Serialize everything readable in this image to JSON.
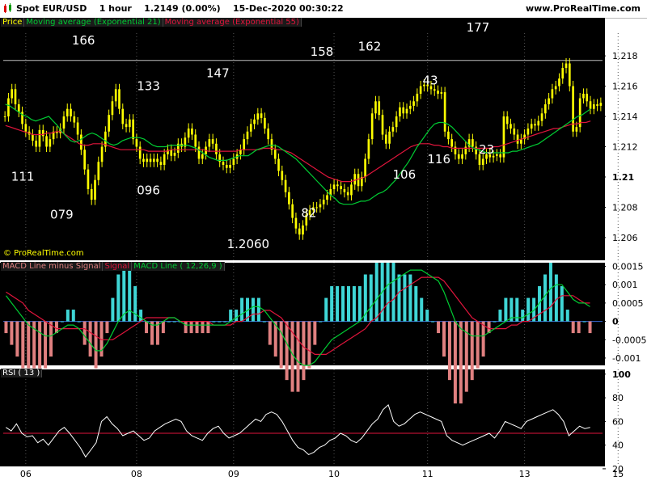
{
  "header": {
    "instrument": "Spot EUR/USD",
    "timeframe": "1 hour",
    "price": "1.2149 (0.00%)",
    "datetime": "15-Dec-2020 00:30:22",
    "site": "www.ProRealTime.com"
  },
  "watermark": "© ProRealTime.com",
  "colors": {
    "background": "#ffffff",
    "panel": "#000000",
    "price": "#ffff00",
    "ema21": "#00cc33",
    "ema55": "#e0153c",
    "macd_hist_pos": "#3fd6d6",
    "macd_hist_neg": "#e08080",
    "signal": "#e0153c",
    "macd_line": "#00cc33",
    "rsi": "#ffffff",
    "rsi_ref": "#e0153c"
  },
  "chart_data": [
    {
      "type": "line",
      "panel": "price",
      "legend": [
        {
          "label": "Price",
          "color": "#ffff00"
        },
        {
          "label": "Moving average (Exponential 21)",
          "color": "#00cc33"
        },
        {
          "label": "Moving average (Exponential 55)",
          "color": "#e0153c"
        }
      ],
      "ylim": [
        1.2045,
        1.2195
      ],
      "y_ticks": [
        "1.206",
        "1.208",
        "1.21",
        "1.212",
        "1.214",
        "1.216",
        "1.218"
      ],
      "y_tick_values": [
        1.206,
        1.208,
        1.21,
        1.212,
        1.214,
        1.216,
        1.218
      ],
      "x_ticks": [
        "06",
        "08",
        "09",
        "10",
        "11",
        "13",
        "15"
      ],
      "x_tick_index": [
        6,
        38,
        66,
        95,
        122,
        150,
        177
      ],
      "reference_line": 1.2177,
      "price": [
        1.214,
        1.2152,
        1.2158,
        1.2148,
        1.2143,
        1.2135,
        1.213,
        1.2128,
        1.2124,
        1.212,
        1.2131,
        1.2127,
        1.212,
        1.2125,
        1.213,
        1.2129,
        1.2132,
        1.214,
        1.2145,
        1.214,
        1.2136,
        1.2128,
        1.2118,
        1.2105,
        1.2092,
        1.2085,
        1.2098,
        1.211,
        1.212,
        1.213,
        1.2141,
        1.215,
        1.2158,
        1.2145,
        1.2135,
        1.2133,
        1.2138,
        1.2125,
        1.212,
        1.2112,
        1.211,
        1.2112,
        1.211,
        1.2112,
        1.211,
        1.2108,
        1.2115,
        1.2118,
        1.2114,
        1.2116,
        1.2122,
        1.212,
        1.2126,
        1.2132,
        1.2128,
        1.212,
        1.2112,
        1.2115,
        1.212,
        1.2125,
        1.2122,
        1.2115,
        1.211,
        1.2108,
        1.2106,
        1.2108,
        1.2112,
        1.2115,
        1.2118,
        1.2125,
        1.213,
        1.2135,
        1.2138,
        1.2142,
        1.2139,
        1.2132,
        1.2125,
        1.2118,
        1.2112,
        1.2104,
        1.2098,
        1.209,
        1.2082,
        1.2073,
        1.2066,
        1.2062,
        1.2068,
        1.2075,
        1.2078,
        1.208,
        1.208,
        1.2082,
        1.2085,
        1.2088,
        1.2092,
        1.2095,
        1.2094,
        1.2092,
        1.209,
        1.2088,
        1.2095,
        1.2102,
        1.2094,
        1.21,
        1.2112,
        1.2125,
        1.2142,
        1.215,
        1.2141,
        1.2128,
        1.2122,
        1.213,
        1.2133,
        1.214,
        1.2146,
        1.2142,
        1.2145,
        1.2147,
        1.215,
        1.2155,
        1.216,
        1.2161,
        1.216,
        1.2158,
        1.2157,
        1.2155,
        1.2156,
        1.213,
        1.2125,
        1.212,
        1.2115,
        1.2112,
        1.2115,
        1.212,
        1.2125,
        1.212,
        1.2115,
        1.2108,
        1.2112,
        1.2115,
        1.2113,
        1.2114,
        1.2115,
        1.2113,
        1.214,
        1.2135,
        1.2132,
        1.2128,
        1.2122,
        1.2125,
        1.2128,
        1.2132,
        1.2135,
        1.2134,
        1.2137,
        1.2142,
        1.2148,
        1.2152,
        1.2158,
        1.216,
        1.2165,
        1.2172,
        1.2175,
        1.216,
        1.213,
        1.2133,
        1.2152,
        1.2155,
        1.215,
        1.2145,
        1.2148,
        1.2147,
        1.2149
      ],
      "ema21": [
        1.2148,
        1.2147,
        1.2145,
        1.2143,
        1.2141,
        1.214,
        1.2138,
        1.2137,
        1.2138,
        1.2139,
        1.214,
        1.2137,
        1.2134,
        1.213,
        1.2127,
        1.2124,
        1.2123,
        1.2124,
        1.2126,
        1.2128,
        1.2129,
        1.2128,
        1.2126,
        1.2124,
        1.2122,
        1.2121,
        1.2122,
        1.2124,
        1.2125,
        1.2126,
        1.2126,
        1.2126,
        1.2125,
        1.2123,
        1.2121,
        1.212,
        1.212,
        1.212,
        1.2121,
        1.2121,
        1.2121,
        1.2121,
        1.2121,
        1.212,
        1.2119,
        1.2117,
        1.2115,
        1.2113,
        1.2112,
        1.2111,
        1.2111,
        1.2111,
        1.2112,
        1.2113,
        1.2114,
        1.2114,
        1.2114,
        1.2116,
        1.2118,
        1.2119,
        1.212,
        1.2121,
        1.2121,
        1.212,
        1.2118,
        1.2116,
        1.2114,
        1.2112,
        1.2109,
        1.2106,
        1.2103,
        1.21,
        1.2097,
        1.2094,
        1.2091,
        1.2088,
        1.2086,
        1.2083,
        1.2082,
        1.2082,
        1.2082,
        1.2083,
        1.2084,
        1.2084,
        1.2085,
        1.2087,
        1.2089,
        1.209,
        1.2092,
        1.2095,
        1.2098,
        1.2102,
        1.2106,
        1.211,
        1.2115,
        1.212,
        1.2124,
        1.2128,
        1.2132,
        1.2135,
        1.2136,
        1.2136,
        1.2135,
        1.2133,
        1.213,
        1.2127,
        1.2124,
        1.2121,
        1.2119,
        1.2118,
        1.2117,
        1.2116,
        1.2116,
        1.2116,
        1.2116,
        1.2116,
        1.2116,
        1.2117,
        1.2117,
        1.2118,
        1.2119,
        1.212,
        1.2121,
        1.2122,
        1.2124,
        1.2126,
        1.2128,
        1.213,
        1.2132,
        1.2134,
        1.2136,
        1.2138,
        1.214,
        1.2141,
        1.2143,
        1.2145
      ],
      "ema55": [
        1.2134,
        1.2133,
        1.2132,
        1.2131,
        1.213,
        1.2129,
        1.2128,
        1.2128,
        1.2128,
        1.2129,
        1.2129,
        1.213,
        1.213,
        1.2128,
        1.2126,
        1.2124,
        1.2122,
        1.2121,
        1.2121,
        1.2122,
        1.2122,
        1.2122,
        1.2121,
        1.212,
        1.2119,
        1.2118,
        1.2118,
        1.2118,
        1.2118,
        1.2118,
        1.2118,
        1.2117,
        1.2117,
        1.2117,
        1.2117,
        1.2117,
        1.2118,
        1.2118,
        1.2118,
        1.2118,
        1.2118,
        1.2118,
        1.2118,
        1.2118,
        1.2117,
        1.2117,
        1.2117,
        1.2117,
        1.2117,
        1.2117,
        1.2117,
        1.2118,
        1.2118,
        1.2118,
        1.2118,
        1.2118,
        1.2119,
        1.2119,
        1.2119,
        1.2118,
        1.2118,
        1.2117,
        1.2116,
        1.2114,
        1.2112,
        1.211,
        1.2108,
        1.2106,
        1.2104,
        1.2102,
        1.21,
        1.2099,
        1.2098,
        1.2097,
        1.2097,
        1.2097,
        1.2098,
        1.2099,
        1.21,
        1.2102,
        1.2104,
        1.2106,
        1.2108,
        1.211,
        1.2112,
        1.2114,
        1.2116,
        1.2118,
        1.212,
        1.2121,
        1.2122,
        1.2122,
        1.2122,
        1.2121,
        1.2121,
        1.212,
        1.212,
        1.2119,
        1.2119,
        1.2119,
        1.2119,
        1.2119,
        1.2119,
        1.2119,
        1.2119,
        1.2119,
        1.212,
        1.212,
        1.2121,
        1.2122,
        1.2123,
        1.2124,
        1.2125,
        1.2126,
        1.2127,
        1.2128,
        1.2129,
        1.213,
        1.2131,
        1.2132,
        1.2132,
        1.2133,
        1.2134,
        1.2135,
        1.2135,
        1.2136,
        1.2136,
        1.2137
      ],
      "annotations": [
        {
          "text": "166",
          "i": 18,
          "y": 1.21875
        },
        {
          "text": "111",
          "i": 4,
          "y": 1.20975
        },
        {
          "text": "079",
          "i": 13,
          "y": 1.20725
        },
        {
          "text": "133",
          "i": 33,
          "y": 1.21575
        },
        {
          "text": "096",
          "i": 33,
          "y": 1.20885
        },
        {
          "text": "147",
          "i": 49,
          "y": 1.2166
        },
        {
          "text": "1.2060",
          "i": 56,
          "y": 1.2053
        },
        {
          "text": "82",
          "i": 70,
          "y": 1.20735
        },
        {
          "text": "158",
          "i": 73,
          "y": 1.218
        },
        {
          "text": "162",
          "i": 84,
          "y": 1.21835
        },
        {
          "text": "106",
          "i": 92,
          "y": 1.2099
        },
        {
          "text": "43",
          "i": 98,
          "y": 1.2161
        },
        {
          "text": "116",
          "i": 100,
          "y": 1.2109
        },
        {
          "text": "177",
          "i": 109,
          "y": 1.2196
        },
        {
          "text": "23",
          "i": 111,
          "y": 1.21155
        }
      ]
    },
    {
      "type": "bar",
      "panel": "macd",
      "legend": [
        {
          "label": "MACD Line minus Signal",
          "color": "#e08080"
        },
        {
          "label": "Signal",
          "color": "#e0153c"
        },
        {
          "label": "MACD Line ( 12,26,9 )",
          "color": "#00cc33"
        }
      ],
      "ylim": [
        -0.0012,
        0.0016
      ],
      "y_ticks": [
        "0.0015",
        "0.001",
        "0.0005",
        "0",
        "-0.0005",
        "-0.001"
      ],
      "y_tick_values": [
        0.0015,
        0.001,
        0.0005,
        0,
        -0.0005,
        -0.001
      ],
      "macd": [
        0.0007,
        0.0005,
        0.0003,
        0.0001,
        -0.0001,
        -0.0002,
        -0.0003,
        -0.0004,
        -0.0004,
        -0.0003,
        -0.0002,
        -0.0001,
        -0.0001,
        -0.0002,
        -0.0004,
        -0.0006,
        -0.0008,
        -0.0008,
        -0.0006,
        -0.0003,
        0.0,
        0.0002,
        0.0003,
        0.0002,
        0.0001,
        0.0,
        -0.0001,
        -0.0001,
        0.0,
        0.0001,
        0.0001,
        0.0,
        -0.0001,
        -0.0001,
        -0.0001,
        -0.0001,
        -0.0001,
        -0.0001,
        -0.0001,
        -0.0001,
        0.0,
        0.0001,
        0.0002,
        0.0003,
        0.0004,
        0.0004,
        0.0003,
        0.0001,
        -0.0001,
        -0.0003,
        -0.0006,
        -0.0009,
        -0.0011,
        -0.0012,
        -0.0012,
        -0.0011,
        -0.0009,
        -0.0007,
        -0.0005,
        -0.0004,
        -0.0003,
        -0.0002,
        -0.0001,
        0.0,
        0.0002,
        0.0004,
        0.0006,
        0.0008,
        0.001,
        0.0011,
        0.0012,
        0.0013,
        0.0014,
        0.0014,
        0.0014,
        0.0013,
        0.0012,
        0.0011,
        0.0008,
        0.0004,
        0.0,
        -0.0002,
        -0.0003,
        -0.0004,
        -0.0004,
        -0.0004,
        -0.0003,
        -0.0002,
        -0.0001,
        0.0,
        0.0001,
        0.0001,
        0.0001,
        0.0002,
        0.0003,
        0.0005,
        0.0007,
        0.0009,
        0.001,
        0.001,
        0.0008,
        0.0006,
        0.0005,
        0.0005,
        0.0004
      ],
      "signal": [
        0.0008,
        0.0007,
        0.0006,
        0.0005,
        0.0003,
        0.0002,
        0.0001,
        0.0,
        -0.0001,
        -0.0002,
        -0.0002,
        -0.0002,
        -0.0002,
        -0.0002,
        -0.0002,
        -0.0003,
        -0.0004,
        -0.0005,
        -0.0005,
        -0.0005,
        -0.0004,
        -0.0003,
        -0.0002,
        -0.0001,
        0.0,
        0.0001,
        0.0001,
        0.0001,
        0.0001,
        0.0001,
        0.0001,
        0.0,
        0.0,
        0.0,
        0.0,
        0.0,
        0.0,
        -0.0001,
        -0.0001,
        -0.0001,
        -0.0001,
        0.0,
        0.0,
        0.0001,
        0.0002,
        0.0002,
        0.0003,
        0.0003,
        0.0002,
        0.0001,
        -0.0001,
        -0.0003,
        -0.0005,
        -0.0007,
        -0.0008,
        -0.0009,
        -0.0009,
        -0.0009,
        -0.0008,
        -0.0007,
        -0.0006,
        -0.0005,
        -0.0004,
        -0.0003,
        -0.0002,
        0.0,
        0.0001,
        0.0003,
        0.0005,
        0.0006,
        0.0008,
        0.0009,
        0.001,
        0.0011,
        0.0012,
        0.0012,
        0.0012,
        0.0012,
        0.0011,
        0.0009,
        0.0007,
        0.0005,
        0.0003,
        0.0001,
        0.0,
        -0.0001,
        -0.0002,
        -0.0002,
        -0.0002,
        -0.0002,
        -0.0001,
        -0.0001,
        0.0,
        0.0,
        0.0001,
        0.0002,
        0.0003,
        0.0004,
        0.0006,
        0.0007,
        0.0007,
        0.0007,
        0.0006,
        0.0005,
        0.0005
      ]
    },
    {
      "type": "line",
      "panel": "rsi",
      "legend": [
        {
          "label": "RSI ( 13 )",
          "color": "#ffffff"
        }
      ],
      "ylim": [
        22,
        104
      ],
      "y_ticks": [
        "100",
        "80",
        "60",
        "40",
        "20"
      ],
      "y_tick_values": [
        100,
        80,
        60,
        40,
        20
      ],
      "reference_line": 50,
      "rsi": [
        55,
        52,
        58,
        50,
        47,
        48,
        42,
        45,
        40,
        46,
        52,
        55,
        50,
        44,
        38,
        30,
        36,
        42,
        60,
        64,
        58,
        54,
        48,
        50,
        52,
        48,
        44,
        46,
        52,
        55,
        58,
        60,
        62,
        60,
        52,
        48,
        46,
        44,
        50,
        54,
        56,
        50,
        46,
        48,
        50,
        54,
        58,
        62,
        60,
        66,
        68,
        66,
        60,
        52,
        44,
        38,
        36,
        32,
        34,
        38,
        40,
        44,
        46,
        50,
        48,
        44,
        42,
        46,
        52,
        58,
        62,
        70,
        74,
        60,
        56,
        58,
        62,
        66,
        68,
        66,
        64,
        62,
        60,
        48,
        44,
        42,
        40,
        42,
        44,
        46,
        48,
        50,
        46,
        52,
        60,
        58,
        56,
        54,
        60,
        62,
        64,
        66,
        68,
        70,
        66,
        60,
        48,
        52,
        56,
        54,
        55
      ]
    }
  ]
}
